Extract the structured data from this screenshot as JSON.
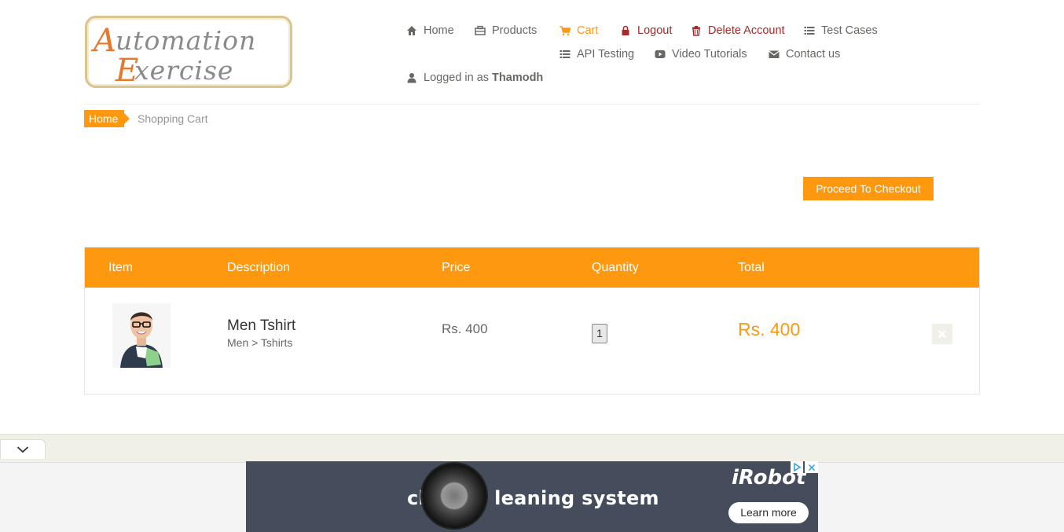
{
  "brand": {
    "logo_line1": "Automation",
    "logo_line2": "Exercise"
  },
  "nav": {
    "home": "Home",
    "products": "Products",
    "cart": "Cart",
    "logout": "Logout",
    "delete_account": "Delete Account",
    "test_cases": "Test Cases",
    "api_testing": "API Testing",
    "video_tutorials": "Video Tutorials",
    "contact_us": "Contact us",
    "logged_in_prefix": "Logged in as",
    "username": "Thamodh"
  },
  "breadcrumb": {
    "home": "Home",
    "current": "Shopping Cart"
  },
  "checkout_button": "Proceed To Checkout",
  "cart": {
    "columns": [
      "Item",
      "Description",
      "Price",
      "Quantity",
      "Total"
    ],
    "items": [
      {
        "name": "Men Tshirt",
        "category": "Men > Tshirts",
        "price": "Rs. 400",
        "quantity": "1",
        "total": "Rs. 400"
      }
    ]
  },
  "ad": {
    "headline_left": "cl",
    "headline_right": "leaning system",
    "brand": "iRobot",
    "cta": "Learn more"
  },
  "colors": {
    "accent": "#FE980F",
    "danger": "#a52a2a",
    "text": "#696763",
    "ad_bg": "#454d5c"
  }
}
